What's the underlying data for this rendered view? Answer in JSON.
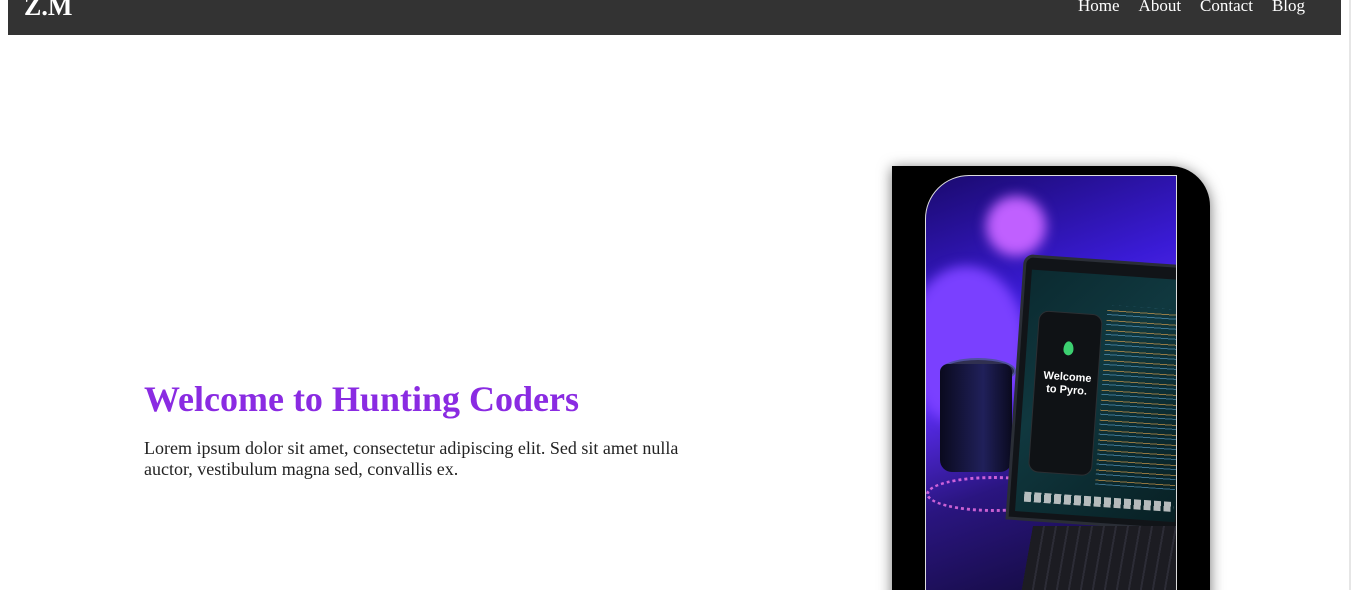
{
  "nav": {
    "brand": "Z.M",
    "links": [
      "Home",
      "About",
      "Contact",
      "Blog"
    ]
  },
  "hero": {
    "title": "Welcome to Hunting Coders",
    "text": "Lorem ipsum dolor sit amet, consectetur adipiscing elit. Sed sit amet nulla auctor, vestibulum magna sed, convallis ex."
  },
  "image": {
    "screen_text": "Welcome to Pyro."
  },
  "colors": {
    "navbar_bg": "#333333",
    "title": "#8a2be2",
    "card_bg": "#000000"
  }
}
